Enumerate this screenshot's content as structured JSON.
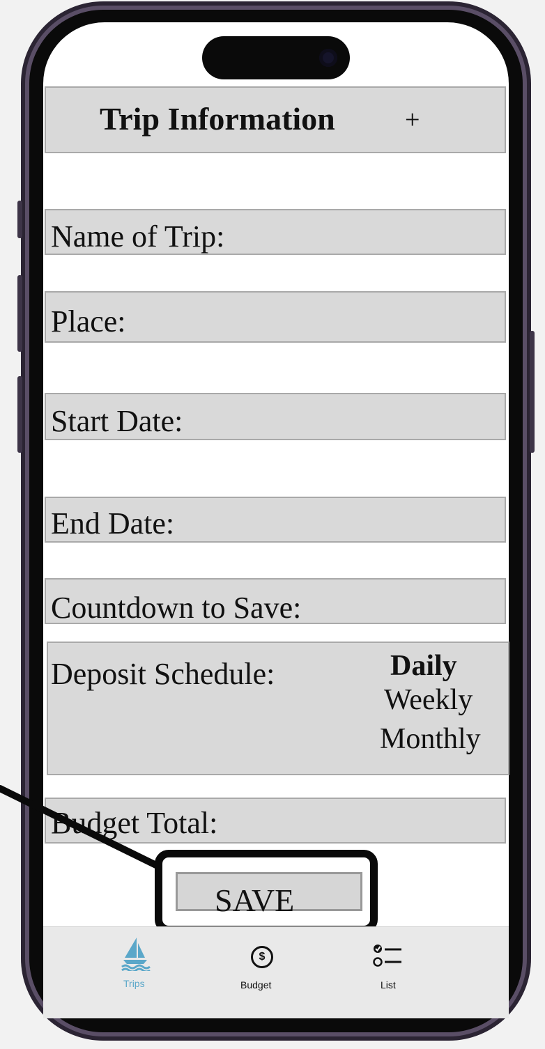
{
  "header": {
    "title": "Trip Information",
    "add_symbol": "+"
  },
  "form": {
    "name_label": "Name of Trip:",
    "place_label": "Place:",
    "start_label": "Start Date:",
    "end_label": "End Date:",
    "countdown_label": "Countdown to Save:",
    "deposit_label": "Deposit Schedule:",
    "deposit_options": [
      "Daily",
      "Weekly",
      "Monthly"
    ],
    "deposit_selected": "Daily",
    "budget_label": "Budget Total:"
  },
  "save_label": "SAVE",
  "tabs": [
    {
      "label": "Trips",
      "icon": "sailboat-icon",
      "active": true
    },
    {
      "label": "Budget",
      "icon": "dollar-circle-icon",
      "active": false
    },
    {
      "label": "List",
      "icon": "checklist-icon",
      "active": false
    }
  ],
  "colors": {
    "accent": "#5aa7c9",
    "field_bg": "#d9d9d9",
    "field_border": "#a9a9a9"
  }
}
